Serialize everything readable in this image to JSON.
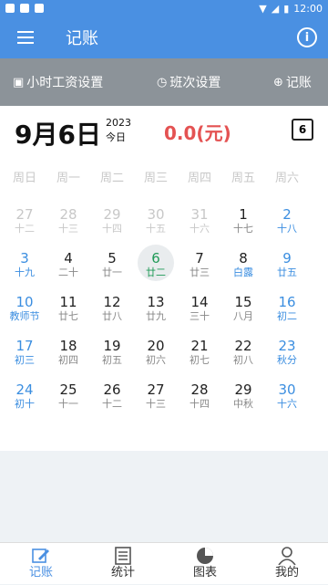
{
  "status": {
    "time": "12:00"
  },
  "appbar": {
    "title": "记账"
  },
  "toolbar": {
    "wage": "小时工资设置",
    "shift": "班次设置",
    "record": "记账"
  },
  "datebar": {
    "date": "9月6日",
    "year": "2023",
    "today": "今日",
    "amount": "0.0(元)",
    "cal_day": "6"
  },
  "weekdays": [
    "周日",
    "周一",
    "周二",
    "周三",
    "周四",
    "周五",
    "周六"
  ],
  "days": [
    {
      "d": "27",
      "l": "十二",
      "t": "other"
    },
    {
      "d": "28",
      "l": "十三",
      "t": "other"
    },
    {
      "d": "29",
      "l": "十四",
      "t": "other"
    },
    {
      "d": "30",
      "l": "十五",
      "t": "other"
    },
    {
      "d": "31",
      "l": "十六",
      "t": "other"
    },
    {
      "d": "1",
      "l": "十七",
      "t": ""
    },
    {
      "d": "2",
      "l": "十八",
      "t": "weekend"
    },
    {
      "d": "3",
      "l": "十九",
      "t": "weekend"
    },
    {
      "d": "4",
      "l": "二十",
      "t": ""
    },
    {
      "d": "5",
      "l": "廿一",
      "t": ""
    },
    {
      "d": "6",
      "l": "廿二",
      "t": "sel"
    },
    {
      "d": "7",
      "l": "廿三",
      "t": ""
    },
    {
      "d": "8",
      "l": "白露",
      "t": "solar"
    },
    {
      "d": "9",
      "l": "廿五",
      "t": "weekend"
    },
    {
      "d": "10",
      "l": "教师节",
      "t": "weekend"
    },
    {
      "d": "11",
      "l": "廿七",
      "t": ""
    },
    {
      "d": "12",
      "l": "廿八",
      "t": ""
    },
    {
      "d": "13",
      "l": "廿九",
      "t": ""
    },
    {
      "d": "14",
      "l": "三十",
      "t": ""
    },
    {
      "d": "15",
      "l": "八月",
      "t": ""
    },
    {
      "d": "16",
      "l": "初二",
      "t": "weekend"
    },
    {
      "d": "17",
      "l": "初三",
      "t": "weekend"
    },
    {
      "d": "18",
      "l": "初四",
      "t": ""
    },
    {
      "d": "19",
      "l": "初五",
      "t": ""
    },
    {
      "d": "20",
      "l": "初六",
      "t": ""
    },
    {
      "d": "21",
      "l": "初七",
      "t": ""
    },
    {
      "d": "22",
      "l": "初八",
      "t": ""
    },
    {
      "d": "23",
      "l": "秋分",
      "t": "weekend"
    },
    {
      "d": "24",
      "l": "初十",
      "t": "weekend"
    },
    {
      "d": "25",
      "l": "十一",
      "t": ""
    },
    {
      "d": "26",
      "l": "十二",
      "t": ""
    },
    {
      "d": "27",
      "l": "十三",
      "t": ""
    },
    {
      "d": "28",
      "l": "十四",
      "t": ""
    },
    {
      "d": "29",
      "l": "中秋",
      "t": ""
    },
    {
      "d": "30",
      "l": "十六",
      "t": "weekend"
    }
  ],
  "tabs": [
    {
      "label": "记账",
      "icon": "edit-icon"
    },
    {
      "label": "统计",
      "icon": "list-icon"
    },
    {
      "label": "图表",
      "icon": "pie-chart-icon"
    },
    {
      "label": "我的",
      "icon": "person-icon"
    }
  ],
  "colors": {
    "primary": "#4a90e2",
    "toolbar": "#8c9399",
    "amount": "#e45252",
    "selected": "#1f9a57"
  }
}
